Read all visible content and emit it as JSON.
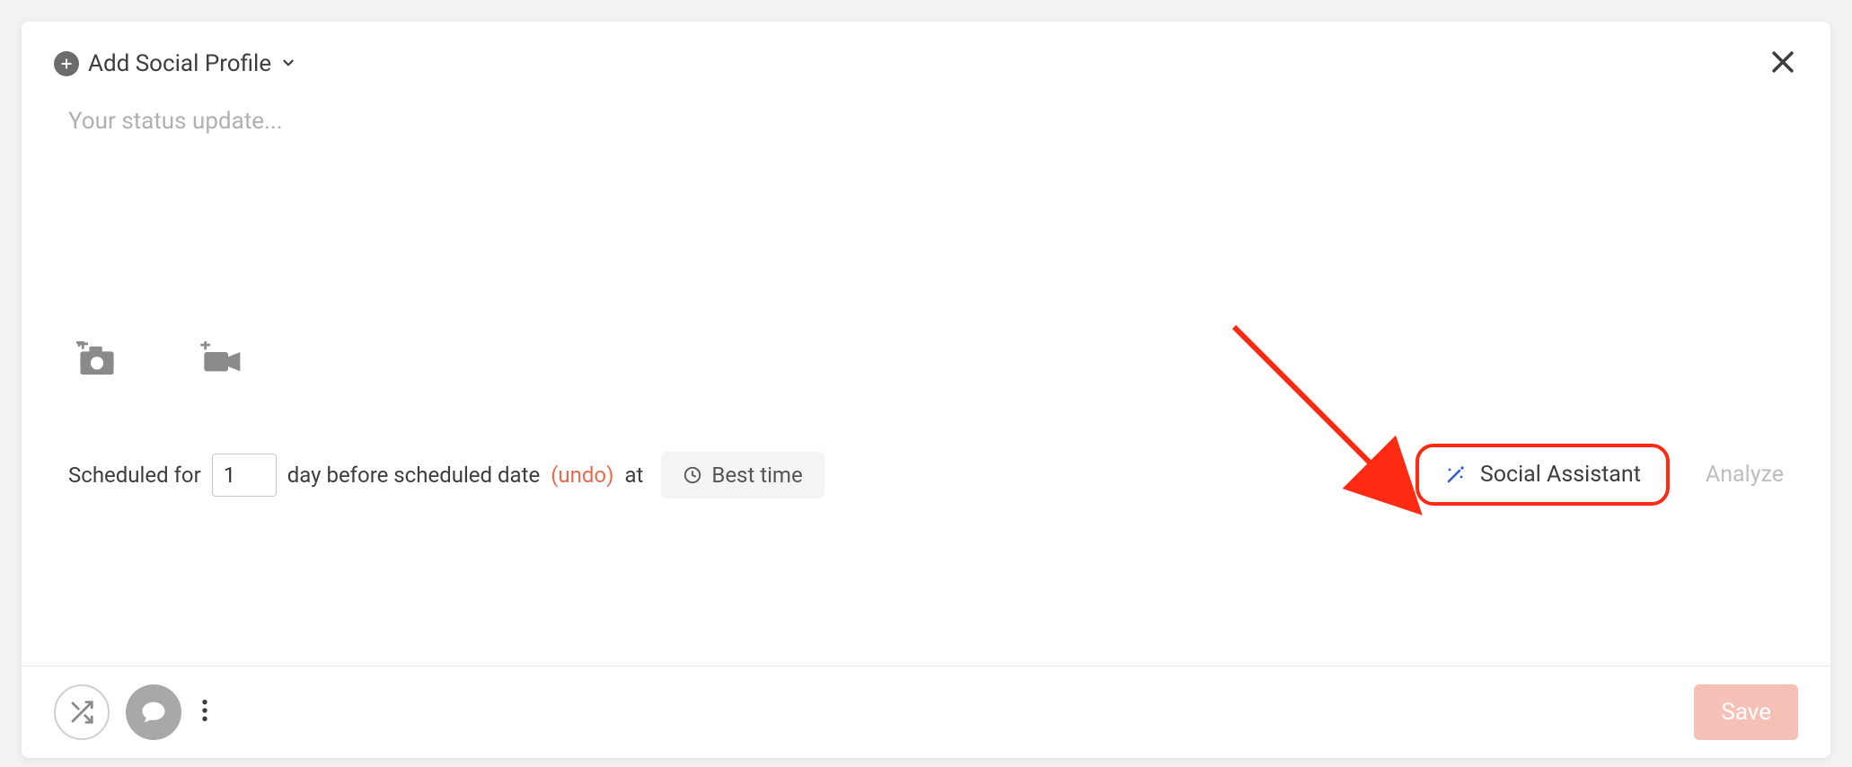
{
  "header": {
    "add_profile_label": "Add Social Profile"
  },
  "composer": {
    "placeholder": "Your status update..."
  },
  "schedule": {
    "prefix": "Scheduled for",
    "day_value": "1",
    "suffix": "day before scheduled date",
    "undo_label": "(undo)",
    "at_label": "at",
    "best_time_label": "Best time"
  },
  "actions": {
    "social_assistant_label": "Social Assistant",
    "analyze_label": "Analyze",
    "save_label": "Save"
  }
}
